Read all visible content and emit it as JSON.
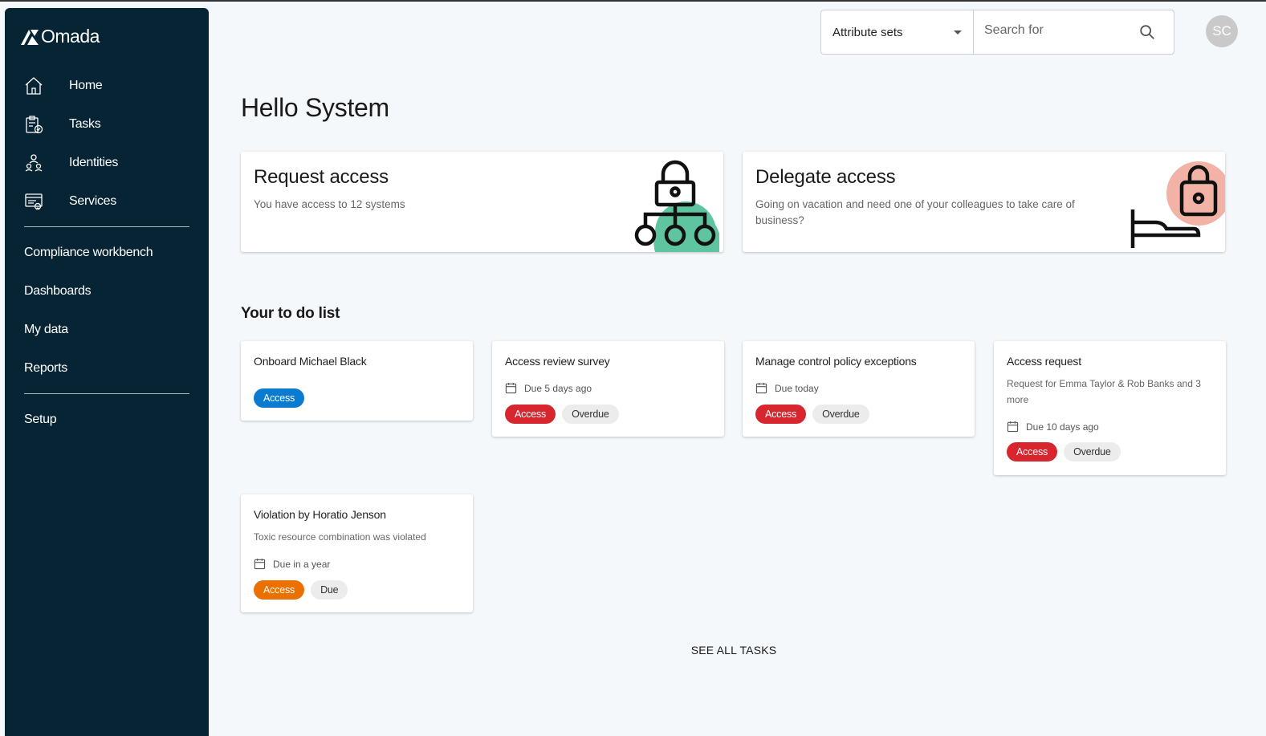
{
  "app": {
    "logo_text": "Omada"
  },
  "sidebar": {
    "primary": [
      {
        "label": "Home",
        "icon": "home-icon"
      },
      {
        "label": "Tasks",
        "icon": "tasks-icon"
      },
      {
        "label": "Identities",
        "icon": "identities-icon"
      },
      {
        "label": "Services",
        "icon": "services-icon"
      }
    ],
    "secondary": [
      {
        "label": "Compliance workbench"
      },
      {
        "label": "Dashboards"
      },
      {
        "label": "My data"
      },
      {
        "label": "Reports"
      }
    ],
    "tertiary": [
      {
        "label": "Setup"
      }
    ]
  },
  "topbar": {
    "attribute_select": "Attribute sets",
    "search_placeholder": "Search for",
    "avatar_initials": "SC"
  },
  "greeting": "Hello System",
  "actions": {
    "request": {
      "title": "Request access",
      "subtitle": "You have access to 12 systems"
    },
    "delegate": {
      "title": "Delegate access",
      "subtitle": "Going on vacation and need one of your colleagues to take care of business?"
    }
  },
  "todo": {
    "title": "Your to do list",
    "tasks": [
      {
        "title": "Onboard Michael Black",
        "tags": [
          "Access"
        ]
      },
      {
        "title": "Access review survey",
        "due": "Due 5 days ago",
        "tags": [
          "Access",
          "Overdue"
        ]
      },
      {
        "title": "Manage control policy exceptions",
        "due": "Due today",
        "tags": [
          "Access",
          "Overdue"
        ]
      },
      {
        "title": "Access request",
        "description": "Request for Emma Taylor & Rob Banks and 3 more",
        "due": "Due 10 days ago",
        "tags": [
          "Access",
          "Overdue"
        ]
      },
      {
        "title": "Violation by Horatio Jenson",
        "description": "Toxic resource combination was violated",
        "due": "Due in a year",
        "tags": [
          "Access",
          "Due"
        ]
      }
    ],
    "see_all": "SEE ALL TASKS"
  },
  "colors": {
    "sidebar_bg": "#062433",
    "tag_blue": "#0b7ad1",
    "tag_red": "#d8262e",
    "tag_orange": "#ec7000",
    "accent_green": "#5fc4a0",
    "accent_pink": "#f2b3a6"
  }
}
